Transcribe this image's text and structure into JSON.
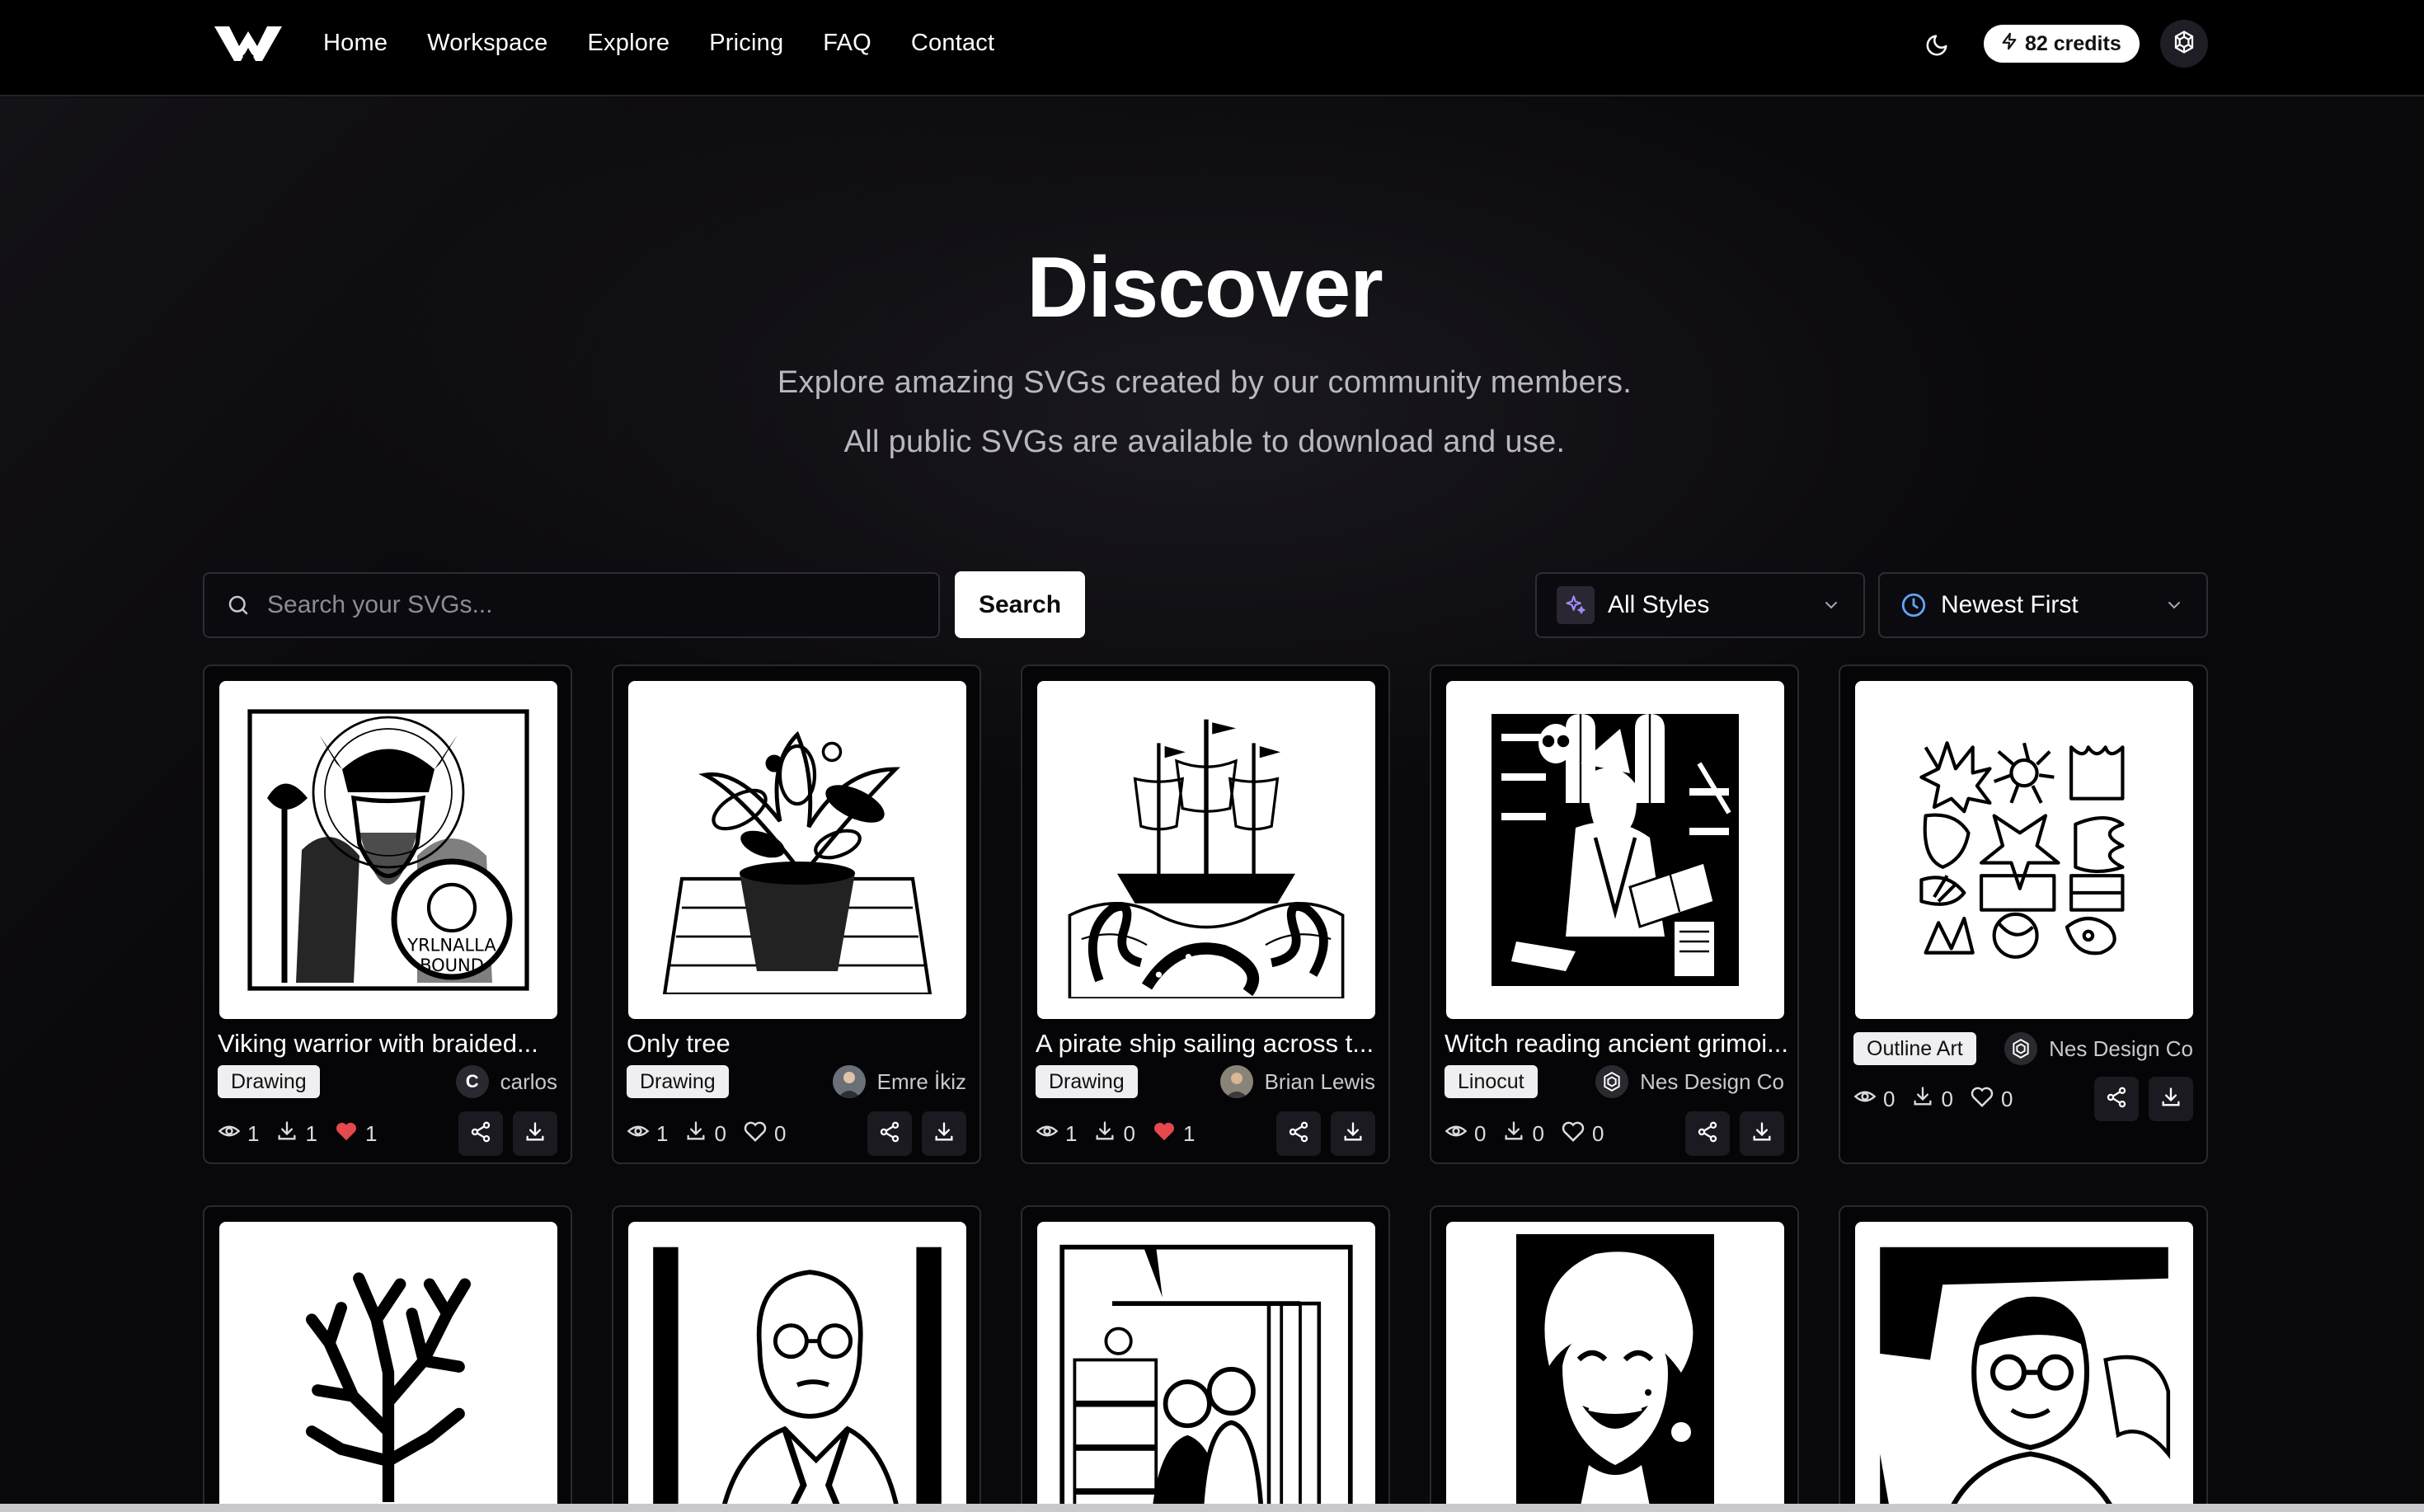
{
  "nav": {
    "logo_icon": "w-logo-icon",
    "links": [
      "Home",
      "Workspace",
      "Explore",
      "Pricing",
      "FAQ",
      "Contact"
    ],
    "theme_icon": "moon-icon",
    "credits": "82 credits",
    "credits_icon": "bolt-icon",
    "account_icon": "openai-logo-icon"
  },
  "hero": {
    "title": "Discover",
    "subtitle_line1": "Explore amazing SVGs created by our community members.",
    "subtitle_line2": "All public SVGs are available to download and use."
  },
  "toolbar": {
    "search_placeholder": "Search your SVGs...",
    "search_value": "",
    "search_button": "Search",
    "style_filter": "All Styles",
    "sort": "Newest First"
  },
  "colors": {
    "background": "#09080b",
    "liked_heart": "#e5484d",
    "badge_bg": "#efeff1",
    "sparkle_accent": "#8b5cf6",
    "clock_accent": "#3b82f6"
  },
  "cards": [
    {
      "title": "Viking warrior with braided...",
      "style": "Drawing",
      "author": "carlos",
      "author_initial": "C",
      "views": "1",
      "downloads": "1",
      "likes": "1",
      "liked": true
    },
    {
      "title": "Only tree",
      "style": "Drawing",
      "author": "Emre İkiz",
      "author_initial": "",
      "views": "1",
      "downloads": "0",
      "likes": "0",
      "liked": false
    },
    {
      "title": "A pirate ship sailing across t...",
      "style": "Drawing",
      "author": "Brian Lewis",
      "author_initial": "",
      "views": "1",
      "downloads": "0",
      "likes": "1",
      "liked": true
    },
    {
      "title": "Witch reading ancient grimoi...",
      "style": "Linocut",
      "author": "Nes Design Co",
      "author_initial": "",
      "views": "0",
      "downloads": "0",
      "likes": "0",
      "liked": false
    },
    {
      "title": "",
      "style": "Outline Art",
      "author": "Nes Design Co",
      "author_initial": "",
      "views": "0",
      "downloads": "0",
      "likes": "0",
      "liked": false
    }
  ]
}
